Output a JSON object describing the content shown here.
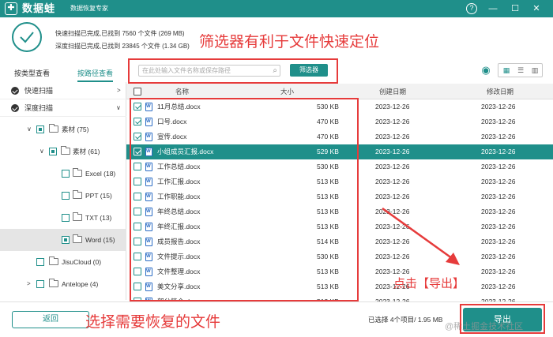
{
  "titlebar": {
    "app_name": "数据蛙",
    "subtitle": "数据恢复专家",
    "logo_glyph": "✚",
    "help_glyph": "?",
    "min_glyph": "—",
    "max_glyph": "☐",
    "close_glyph": "✕"
  },
  "scan_status": {
    "quick": "快速扫描已完成,已找到 7560 个文件 (269 MB)",
    "deep": "深度扫描已完成,已找到 23845 个文件 (1.34 GB)"
  },
  "annotations": {
    "filter_tip": "筛选器有利于文件快速定位",
    "select_tip": "选择需要恢复的文件",
    "export_tip": "点击【导出】"
  },
  "tabs": [
    {
      "label": "按类型查看",
      "active": false
    },
    {
      "label": "按路径查看",
      "active": true
    }
  ],
  "search": {
    "placeholder": "在此处输入文件名称或保存路径",
    "filter_label": "筛选器",
    "search_glyph": "⌕"
  },
  "view_controls": {
    "eye_glyph": "◉",
    "grid_glyph": "▦",
    "list_glyph": "☰",
    "panel_glyph": "▥"
  },
  "sidebar": {
    "top_items": [
      {
        "label": "快速扫描"
      },
      {
        "label": "深度扫描"
      }
    ],
    "tree": [
      {
        "label": "素材 (75)"
      },
      {
        "label": "素材 (61)"
      },
      {
        "label": "Excel (18)"
      },
      {
        "label": "PPT (15)"
      },
      {
        "label": "TXT (13)"
      },
      {
        "label": "Word (15)"
      },
      {
        "label": "JisuCloud (0)"
      },
      {
        "label": "Antelope (4)"
      }
    ]
  },
  "table": {
    "headers": {
      "name": "名称",
      "size": "大小",
      "created": "创建日期",
      "modified": "修改日期"
    },
    "rows": [
      {
        "checked": true,
        "name": "11月总结.docx",
        "size": "530 KB",
        "created": "2023-12-26",
        "modified": "2023-12-26"
      },
      {
        "checked": true,
        "name": "口号.docx",
        "size": "470 KB",
        "created": "2023-12-26",
        "modified": "2023-12-26"
      },
      {
        "checked": true,
        "name": "宣传.docx",
        "size": "470 KB",
        "created": "2023-12-26",
        "modified": "2023-12-26"
      },
      {
        "checked": true,
        "name": "小组成员汇报.docx",
        "size": "529 KB",
        "created": "2023-12-26",
        "modified": "2023-12-26",
        "highlight": true
      },
      {
        "checked": false,
        "name": "工作总结.docx",
        "size": "530 KB",
        "created": "2023-12-26",
        "modified": "2023-12-26"
      },
      {
        "checked": false,
        "name": "工作汇报.docx",
        "size": "513 KB",
        "created": "2023-12-26",
        "modified": "2023-12-26"
      },
      {
        "checked": false,
        "name": "工作职能.docx",
        "size": "513 KB",
        "created": "2023-12-26",
        "modified": "2023-12-26"
      },
      {
        "checked": false,
        "name": "年终总结.docx",
        "size": "513 KB",
        "created": "2023-12-26",
        "modified": "2023-12-26"
      },
      {
        "checked": false,
        "name": "年终汇报.docx",
        "size": "513 KB",
        "created": "2023-12-26",
        "modified": "2023-12-26"
      },
      {
        "checked": false,
        "name": "成员报告.docx",
        "size": "514 KB",
        "created": "2023-12-26",
        "modified": "2023-12-26"
      },
      {
        "checked": false,
        "name": "文件提示.docx",
        "size": "530 KB",
        "created": "2023-12-26",
        "modified": "2023-12-26"
      },
      {
        "checked": false,
        "name": "文件整理.docx",
        "size": "513 KB",
        "created": "2023-12-26",
        "modified": "2023-12-26"
      },
      {
        "checked": false,
        "name": "美文分享.docx",
        "size": "513 KB",
        "created": "2023-12-26",
        "modified": "2023-12-26"
      },
      {
        "checked": false,
        "name": "部分简介.docx",
        "size": "513 KB",
        "created": "2023-12-26",
        "modified": "2023-12-26"
      }
    ]
  },
  "bottom": {
    "back_label": "返回",
    "selection_info": "已选择 4个项目/ 1.95 MB",
    "export_label": "导出",
    "watermark": "@稀土掘金技术社区"
  },
  "colors": {
    "accent": "#1f8f8a",
    "annotation_red": "#e63b3b"
  }
}
